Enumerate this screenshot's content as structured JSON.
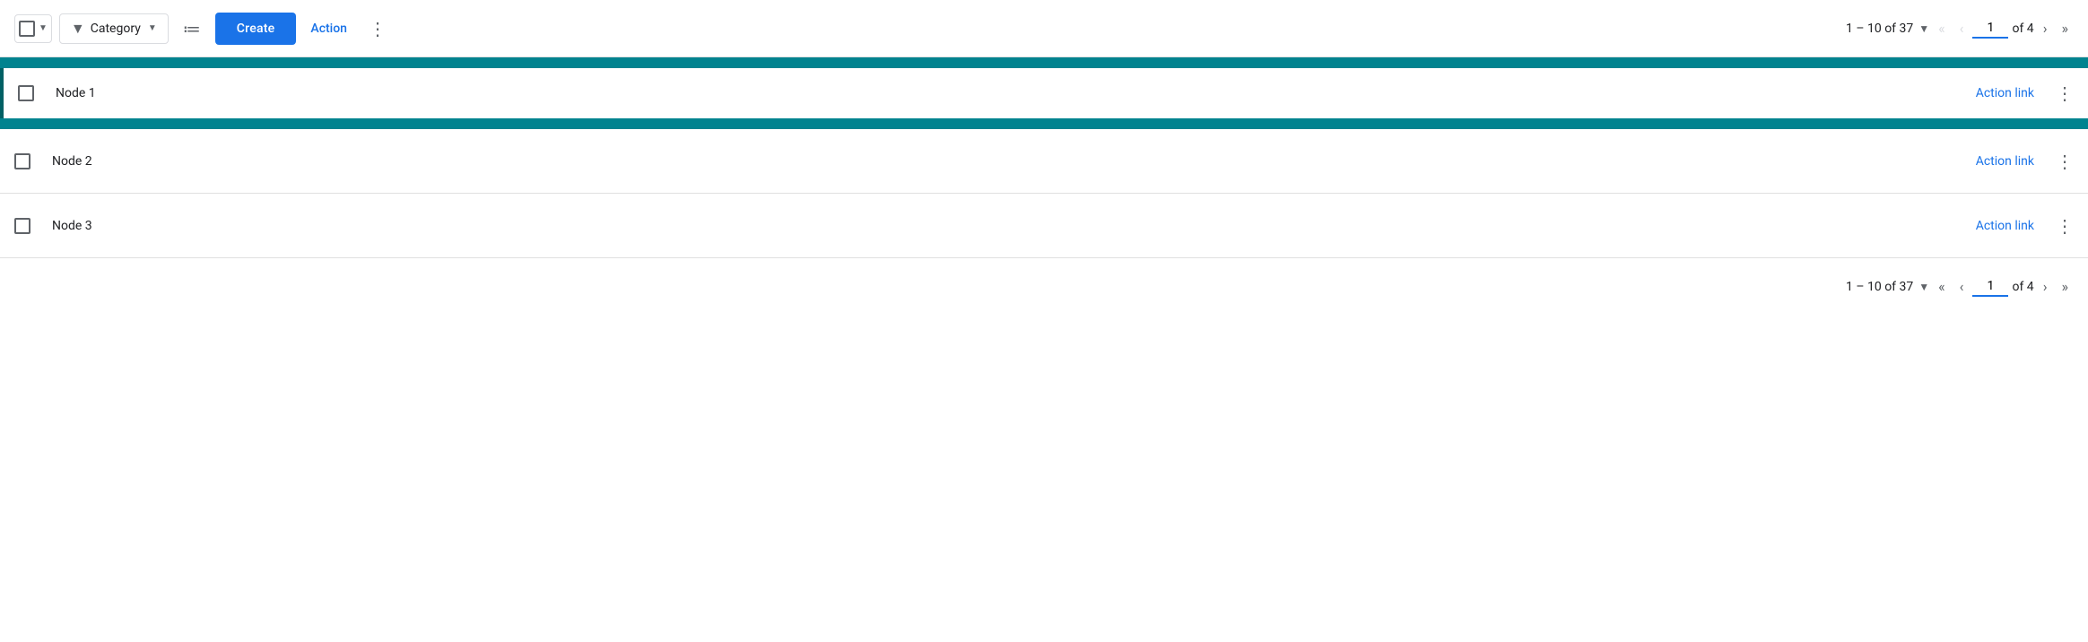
{
  "toolbar": {
    "checkbox_label": "Select all",
    "filter_label": "Category",
    "sort_label": "Sort",
    "create_label": "Create",
    "action_label": "Action",
    "more_label": "⋮"
  },
  "pagination_top": {
    "range": "1 – 10 of 37",
    "page": "1",
    "of_total": "of 4"
  },
  "pagination_bottom": {
    "range": "1 – 10 of 37",
    "page": "1",
    "of_total": "of 4"
  },
  "rows": [
    {
      "id": 1,
      "label": "Node 1",
      "action_link": "Action link",
      "selected": true
    },
    {
      "id": 2,
      "label": "Node 2",
      "action_link": "Action link",
      "selected": false
    },
    {
      "id": 3,
      "label": "Node 3",
      "action_link": "Action link",
      "selected": false
    }
  ]
}
